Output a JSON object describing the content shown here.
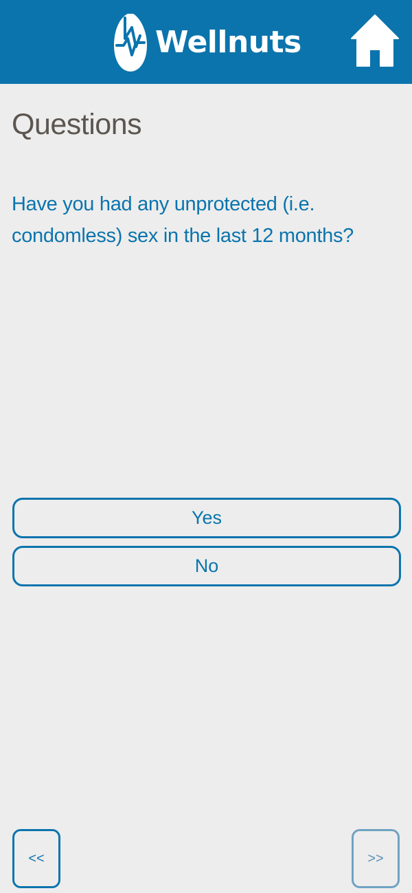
{
  "header": {
    "brand_name": "Wellnuts",
    "logo_icon": "wellnuts-logo-icon",
    "home_icon": "home-icon",
    "background_color": "#0b74ad"
  },
  "page": {
    "title": "Questions"
  },
  "question": {
    "text": "Have you had any unprotected (i.e. condomless) sex in the last 12 months?"
  },
  "answers": [
    {
      "label": "Yes"
    },
    {
      "label": "No"
    }
  ],
  "navigation": {
    "prev_label": "<<",
    "next_label": ">>"
  },
  "colors": {
    "accent": "#0b74ad",
    "title_text": "#5c5650",
    "background": "#ededed"
  }
}
